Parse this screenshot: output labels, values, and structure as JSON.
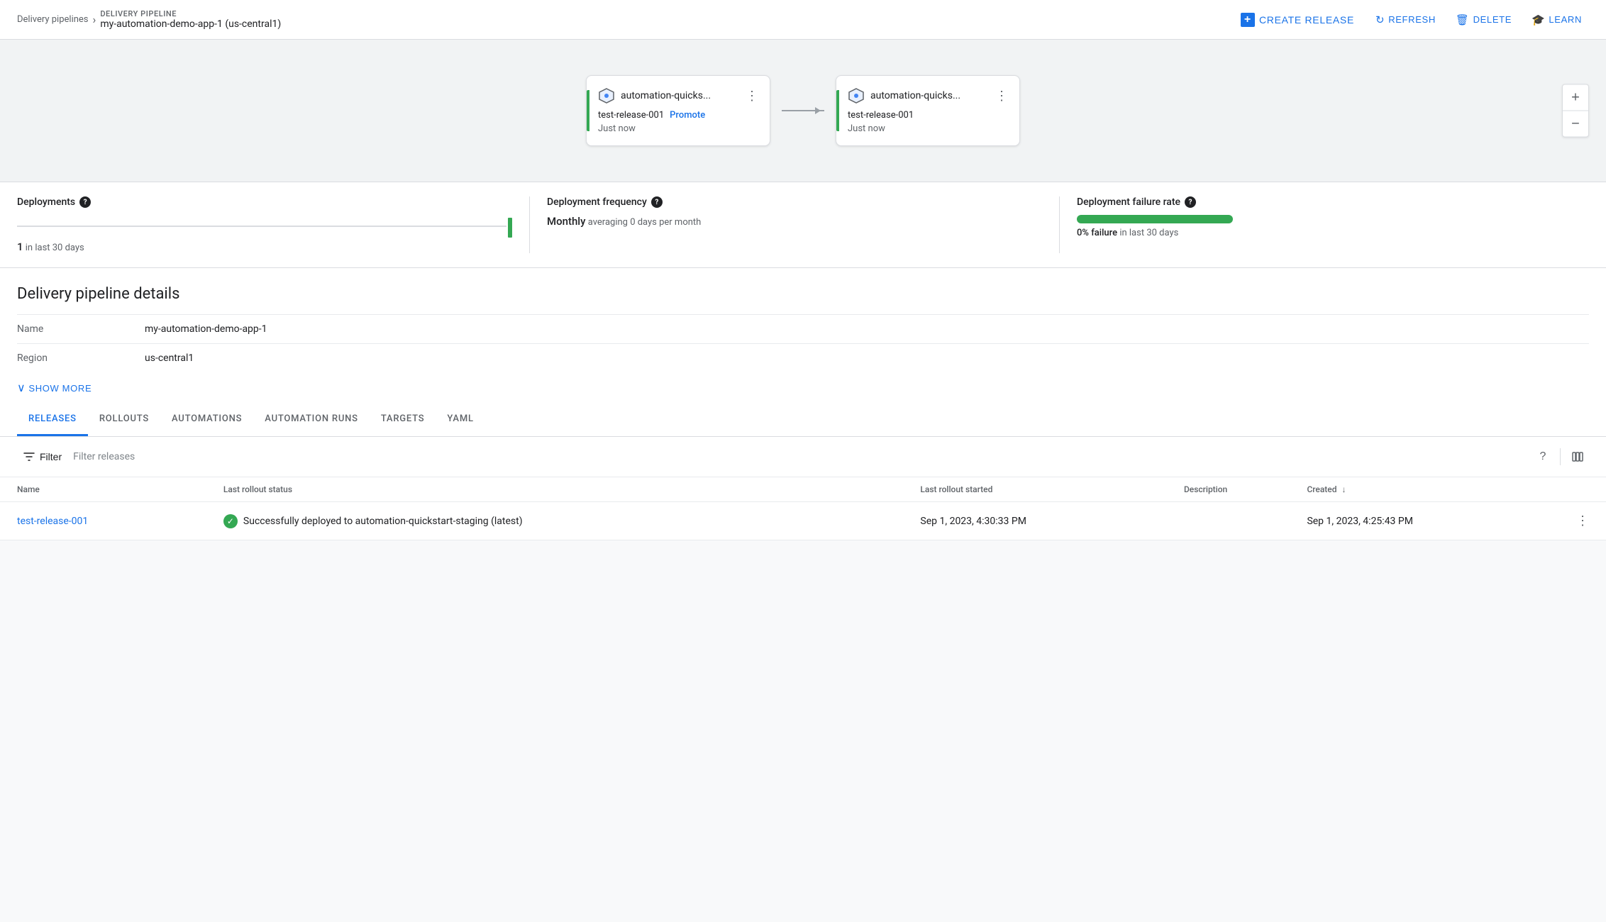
{
  "topbar": {
    "breadcrumb_link": "Delivery pipelines",
    "section_label": "DELIVERY PIPELINE",
    "pipeline_name": "my-automation-demo-app-1 (us-central1)",
    "create_release_label": "CREATE RELEASE",
    "refresh_label": "REFRESH",
    "delete_label": "DELETE",
    "learn_label": "LEARN"
  },
  "pipeline": {
    "node1": {
      "name": "automation-quicks...",
      "release": "test-release-001",
      "promote_label": "Promote",
      "time": "Just now"
    },
    "node2": {
      "name": "automation-quicks...",
      "release": "test-release-001",
      "time": "Just now"
    }
  },
  "zoom": {
    "plus": "+",
    "minus": "−"
  },
  "metrics": {
    "deployments_label": "Deployments",
    "deployments_value": "1",
    "deployments_period": "in last 30 days",
    "frequency_label": "Deployment frequency",
    "frequency_value": "Monthly",
    "frequency_sub": "averaging 0 days per month",
    "failure_label": "Deployment failure rate",
    "failure_value": "0% failure",
    "failure_sub": "in last 30 days"
  },
  "details": {
    "section_title": "Delivery pipeline details",
    "name_label": "Name",
    "name_value": "my-automation-demo-app-1",
    "region_label": "Region",
    "region_value": "us-central1",
    "show_more_label": "SHOW MORE"
  },
  "tabs": [
    {
      "id": "releases",
      "label": "RELEASES",
      "active": true
    },
    {
      "id": "rollouts",
      "label": "ROLLOUTS",
      "active": false
    },
    {
      "id": "automations",
      "label": "AUTOMATIONS",
      "active": false
    },
    {
      "id": "automation-runs",
      "label": "AUTOMATION RUNS",
      "active": false
    },
    {
      "id": "targets",
      "label": "TARGETS",
      "active": false
    },
    {
      "id": "yaml",
      "label": "YAML",
      "active": false
    }
  ],
  "filter": {
    "icon_label": "Filter",
    "placeholder": "Filter releases"
  },
  "table": {
    "columns": [
      {
        "id": "name",
        "label": "Name"
      },
      {
        "id": "rollout_status",
        "label": "Last rollout status"
      },
      {
        "id": "rollout_started",
        "label": "Last rollout started"
      },
      {
        "id": "description",
        "label": "Description"
      },
      {
        "id": "created",
        "label": "Created",
        "sort": true
      }
    ],
    "rows": [
      {
        "name": "test-release-001",
        "rollout_status": "Successfully deployed to automation-quickstart-staging (latest)",
        "rollout_started": "Sep 1, 2023, 4:30:33 PM",
        "description": "",
        "created": "Sep 1, 2023, 4:25:43 PM"
      }
    ]
  }
}
